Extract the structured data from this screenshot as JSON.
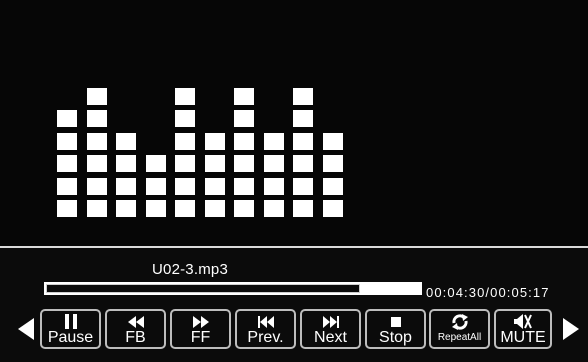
{
  "player": {
    "filename": "U02-3.mp3",
    "time": "00:04:30/00:05:17",
    "progress_fraction": 0.84
  },
  "equalizer": {
    "bar_heights_in_blocks": [
      5,
      6,
      4,
      3,
      6,
      4,
      6,
      4,
      6,
      4
    ],
    "max_blocks": 8
  },
  "controls": [
    {
      "name": "pause-button",
      "label": "Pause",
      "icon": "pause-icon"
    },
    {
      "name": "fb-button",
      "label": "FB",
      "icon": "fast-backward-icon"
    },
    {
      "name": "ff-button",
      "label": "FF",
      "icon": "fast-forward-icon"
    },
    {
      "name": "prev-button",
      "label": "Prev.",
      "icon": "previous-track-icon"
    },
    {
      "name": "next-button",
      "label": "Next",
      "icon": "next-track-icon"
    },
    {
      "name": "stop-button",
      "label": "Stop",
      "icon": "stop-icon"
    },
    {
      "name": "repeat-all-button",
      "label": "RepeatAll",
      "icon": "repeat-icon"
    },
    {
      "name": "mute-button",
      "label": "MUTE",
      "icon": "mute-icon"
    }
  ],
  "navigation": {
    "left_icon": "left-arrow-icon",
    "right_icon": "right-arrow-icon"
  }
}
